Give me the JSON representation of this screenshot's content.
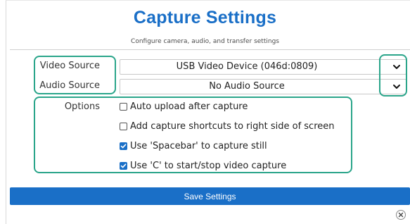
{
  "header": {
    "title": "Capture Settings",
    "subtitle": "Configure camera, audio, and transfer settings"
  },
  "video_source": {
    "label": "Video Source",
    "selected": "USB Video Device (046d:0809)"
  },
  "audio_source": {
    "label": "Audio Source",
    "selected": "No Audio Source"
  },
  "options": {
    "label": "Options",
    "items": [
      {
        "label": "Auto upload after capture",
        "checked": false
      },
      {
        "label": "Add capture shortcuts to right side of screen",
        "checked": false
      },
      {
        "label": "Use 'Spacebar' to capture still",
        "checked": true
      },
      {
        "label": "Use 'C' to start/stop video capture",
        "checked": true
      }
    ]
  },
  "save_button": {
    "label": "Save Settings"
  },
  "colors": {
    "accent": "#1a6fc7",
    "highlight": "#2aa58a"
  },
  "icons": {
    "dropdown": "chevron-down-icon",
    "checkbox_checked": "check-icon",
    "close": "close-icon"
  }
}
